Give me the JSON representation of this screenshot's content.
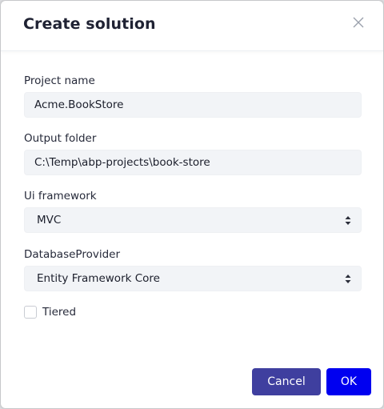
{
  "dialog": {
    "title": "Create solution"
  },
  "fields": {
    "project_name": {
      "label": "Project name",
      "value": "Acme.BookStore"
    },
    "output_folder": {
      "label": "Output folder",
      "value": "C:\\Temp\\abp-projects\\book-store"
    },
    "ui_framework": {
      "label": "Ui framework",
      "selected": "MVC"
    },
    "database_provider": {
      "label": "DatabaseProvider",
      "selected": "Entity Framework Core"
    },
    "tiered": {
      "label": "Tiered",
      "checked": false
    }
  },
  "footer": {
    "cancel_label": "Cancel",
    "ok_label": "OK"
  },
  "colors": {
    "cancel_button": "#3f3f9f",
    "ok_button": "#0000f0",
    "input_background": "#f2f4f7"
  },
  "icons": {
    "close": "close-icon",
    "select_caret": "sort-caret-icon"
  }
}
